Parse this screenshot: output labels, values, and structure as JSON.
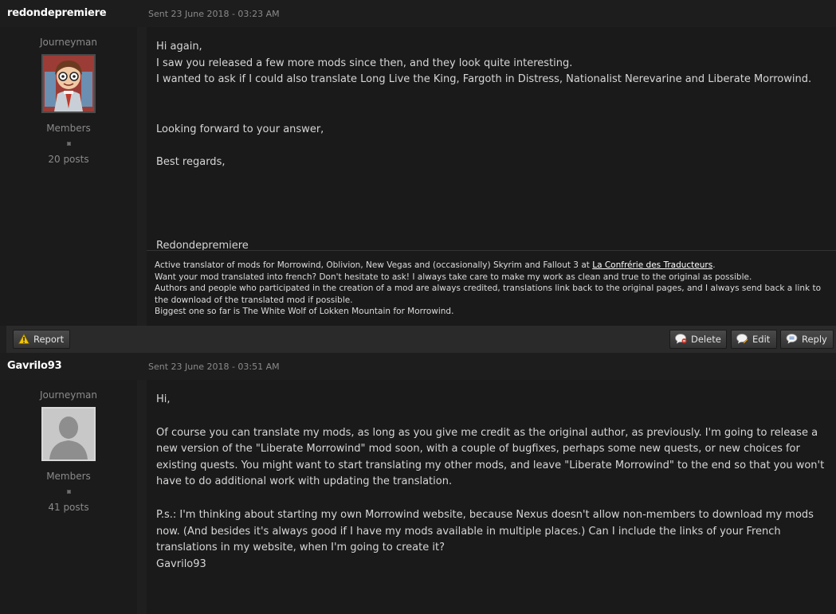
{
  "posts": [
    {
      "author": "redondepremiere",
      "date": "Sent 23 June 2018 - 03:23 AM",
      "rank": "Journeyman",
      "group": "Members",
      "post_count": "20 posts",
      "avatar": "cartoon-avatar",
      "body": [
        "Hi again,",
        "I saw you released a few more mods since then, and they look quite interesting.",
        "I wanted to ask if I could also translate Long Live the King, Fargoth in Distress, Nationalist Nerevarine and Liberate Morrowind.",
        "",
        "",
        "Looking forward to your answer,",
        "",
        "Best regards,",
        "",
        "",
        "",
        "",
        "Redondepremiere"
      ],
      "signature": {
        "line1_before_link": "Active translator of mods for Morrowind, Oblivion, New Vegas and (occasionally) Skyrim and Fallout 3 at ",
        "link_text": "La Confrérie des Traducteurs",
        "line1_after_link": ".",
        "line2": "Want your mod translated into french? Don't hesitate to ask! I always take care to make my work as clean and true to the original as possible.",
        "line3": "Authors and people who participated in the creation of a mod are always credited, translations link back to the original pages, and I always send back a link to the download of the translated mod if possible.",
        "line4": "Biggest one so far is The White Wolf of Lokken Mountain for Morrowind."
      },
      "actions": {
        "report": "Report",
        "delete": "Delete",
        "edit": "Edit",
        "reply": "Reply"
      }
    },
    {
      "author": "Gavrilo93",
      "date": "Sent 23 June 2018 - 03:51 AM",
      "rank": "Journeyman",
      "group": "Members",
      "post_count": "41 posts",
      "avatar": "default-user-avatar",
      "body": [
        "Hi,",
        "",
        "Of course you can translate my mods, as long as you give me credit as the original author, as previously. I'm going to release a new version of the \"Liberate Morrowind\" mod soon, with a couple of bugfixes, perhaps some new quests, or new choices for existing quests. You might want to start translating my other mods, and leave \"Liberate Morrowind\" to the end so that you won't have to do additional work with updating the translation.",
        "",
        "P.s.: I'm thinking about starting my own Morrowind website, because Nexus doesn't allow non-members to download my mods now. (And besides it's always good if I have my mods available in multiple places.) Can I include the links of your French translations in my website, when I'm going to create it?",
        "Gavrilo93"
      ]
    }
  ],
  "colors": {
    "background": "#1f1f1f",
    "text": "#d2d2d2",
    "muted": "#8a8a8a",
    "button": "#3c3c3c",
    "report_icon": "#f2c500"
  }
}
